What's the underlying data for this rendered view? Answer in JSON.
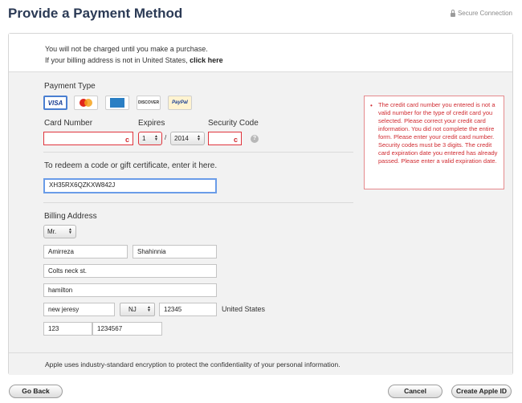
{
  "header": {
    "title": "Provide a Payment Method",
    "secure_label": "Secure Connection"
  },
  "notice": {
    "line1": "You will not be charged until you make a purchase.",
    "line2_prefix": "If your billing address is not in United States, ",
    "line2_link": "click here"
  },
  "payment": {
    "type_label": "Payment Type",
    "cards": [
      "VISA",
      "MasterCard",
      "AMEX",
      "DISCOVER",
      "PayPal"
    ],
    "selected_card": "VISA",
    "card_number_label": "Card Number",
    "card_number_value": "",
    "expires_label": "Expires",
    "expires_month": "1",
    "expires_sep": "/",
    "expires_year": "2014",
    "security_label": "Security Code",
    "security_value": "",
    "help_glyph": "?"
  },
  "redeem": {
    "label": "To redeem a code or gift certificate, enter it here.",
    "value": "XH35RX6QZKXW842J"
  },
  "billing": {
    "label": "Billing Address",
    "title": "Mr.",
    "first_name": "Amirreza",
    "last_name": "Shahinnia",
    "street1": "Colts neck st.",
    "street2": "hamilton",
    "city": "new jeresy",
    "state": "NJ",
    "zip": "12345",
    "country": "United States",
    "area_code": "123",
    "phone": "1234567"
  },
  "error": {
    "bullet": "•",
    "message": "The credit card number you entered is not a valid number for the type of credit card you selected. Please correct your credit card information. You did not complete the entire form. Please enter your credit card number. Security codes must be 3 digits. The credit card expiration date you entered has already passed. Please enter a valid expiration date."
  },
  "footer": {
    "text": "Apple uses industry-standard encryption to protect the confidentiality of your personal information."
  },
  "buttons": {
    "back": "Go Back",
    "cancel": "Cancel",
    "create": "Create Apple ID"
  },
  "colors": {
    "title": "#2b3a55",
    "error": "#d02a30",
    "focus": "#6a9ce8"
  }
}
